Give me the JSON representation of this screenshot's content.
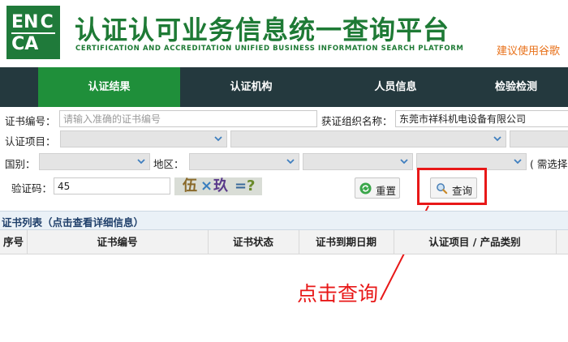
{
  "header": {
    "logo_letters": [
      "EN",
      "C",
      "CA"
    ],
    "title_cn": "认证认可业务信息统一查询平台",
    "title_en": "CERTIFICATION AND ACCREDITATION UNIFIED BUSINESS INFORMATION SEARCH PLATFORM",
    "browser_tip": "建议使用谷歌"
  },
  "nav": {
    "items": [
      {
        "label": "认证结果",
        "active": true
      },
      {
        "label": "认证机构",
        "active": false
      },
      {
        "label": "人员信息",
        "active": false
      },
      {
        "label": "检验检测",
        "active": false
      }
    ]
  },
  "form": {
    "cert_no_label": "证书编号：",
    "cert_no_placeholder": "请输入准确的证书编号",
    "cert_no_value": "",
    "org_name_label": "获证组织名称：",
    "org_name_value": "东莞市祥科机电设备有限公司",
    "cert_project_label": "认证项目：",
    "country_label": "国别：",
    "region_label": "地区：",
    "need_select_note": "( 需选择",
    "captcha_label": "验证码：",
    "captcha_value": "45",
    "captcha_image": {
      "part1": "伍",
      "op": "×",
      "part2": "玖",
      "eq": "=",
      "q": "?"
    },
    "reset_button": "重置",
    "search_button": "查询"
  },
  "annotation": {
    "text": "点击查询",
    "color": "#e81818"
  },
  "list": {
    "title": "证书列表（点击查看详细信息）",
    "columns": [
      "序号",
      "证书编号",
      "证书状态",
      "证书到期日期",
      "认证项目 / 产品类别"
    ]
  },
  "colors": {
    "brand_green": "#1f7a3a",
    "nav_bg": "#24393e",
    "nav_active": "#1f8f3a",
    "tip_orange": "#e8711a"
  }
}
